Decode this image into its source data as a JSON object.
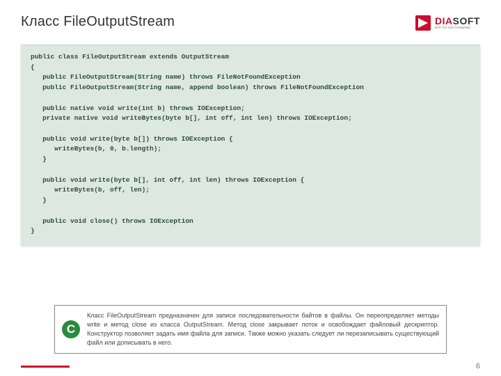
{
  "header": {
    "title": "Класс FileOutputStream",
    "brand_dia": "DIA",
    "brand_soft": "SOFT",
    "tagline": "всё по-настоящему"
  },
  "code": "public class FileOutputStream extends OutputStream\n{\n   public FileOutputStream(String name) throws FileNotFoundException\n   public FileOutputStream(String name, append boolean) throws FileNotFoundException\n\n   public native void write(int b) throws IOException;\n   private native void writeBytes(byte b[], int off, int len) throws IOException;\n\n   public void write(byte b[]) throws IOException {\n      writeBytes(b, 0, b.length);\n   }\n\n   public void write(byte b[], int off, int len) throws IOException {\n      writeBytes(b, off, len);\n   }\n\n   public void close() throws IOException\n}",
  "note": {
    "icon_letter": "C",
    "text": "Класс FileOutputStream предназначен для записи последовательности байтов в файлы. Он переопределяет методы write и метод close из класса OutputStream. Метод close закрывает поток и освобождает файловый дескриптор. Конструктор позволяет задать имя файла для записи. Также можно указать следует ли перезаписывать существующий файл или дописывать в него."
  },
  "page_number": "6"
}
